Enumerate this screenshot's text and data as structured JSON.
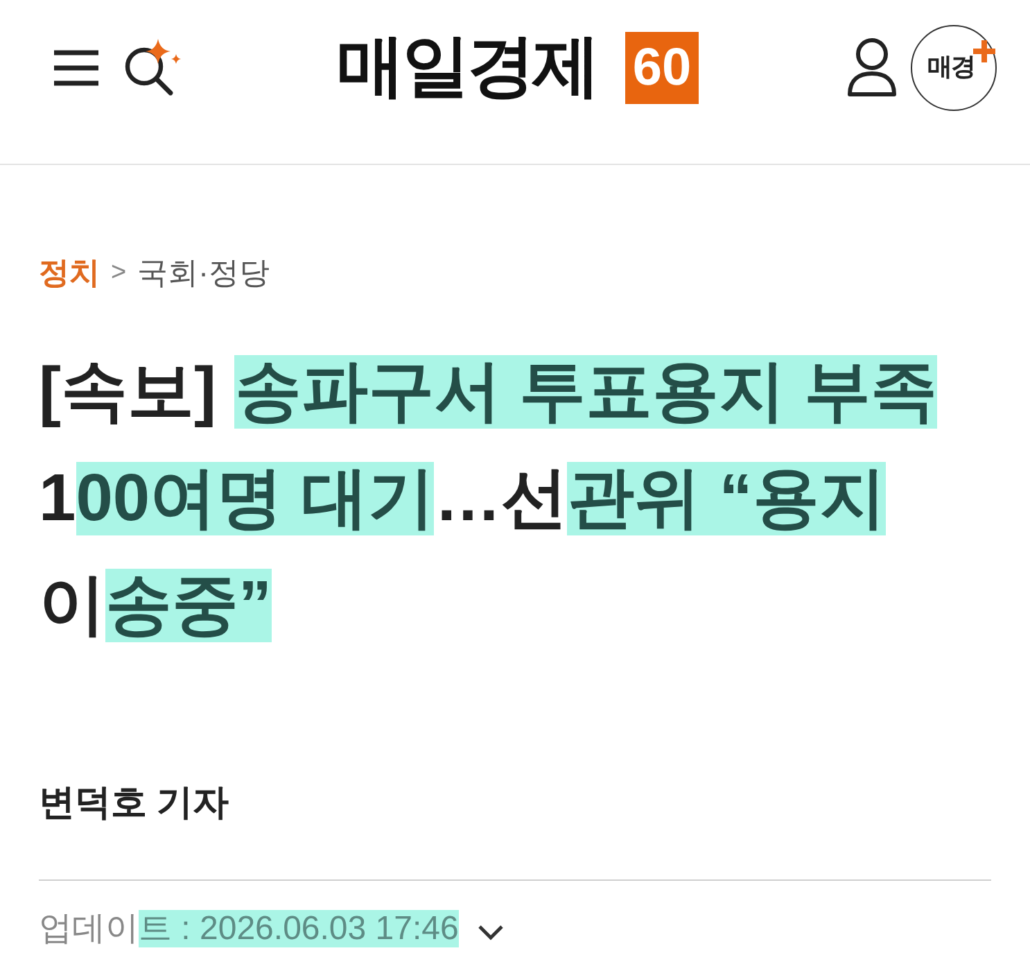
{
  "header": {
    "logo": {
      "text": "매일경제",
      "badge": "60"
    },
    "premium_button": {
      "label": "매경"
    }
  },
  "breadcrumb": {
    "section": "정치",
    "separator": ">",
    "subsection": "국회·정당"
  },
  "headline": {
    "lines": [
      [
        {
          "text": "[속보] ",
          "highlighted": false
        },
        {
          "text": "송파구서 투표용지 부족",
          "highlighted": true
        }
      ],
      [
        {
          "text": "1",
          "highlighted": false
        },
        {
          "text": "00여명 대기",
          "highlighted": true
        },
        {
          "text": "…선",
          "highlighted": false
        },
        {
          "text": "관위 “용지",
          "highlighted": true
        }
      ],
      [
        {
          "text": "이",
          "highlighted": false
        },
        {
          "text": "송중”",
          "highlighted": true
        }
      ]
    ]
  },
  "byline": {
    "author": "변덕호 기자"
  },
  "update": {
    "segments": [
      {
        "text": "업데이",
        "highlighted": false
      },
      {
        "text": "트 : 2026.06.03 17:46",
        "highlighted": true
      }
    ]
  }
}
